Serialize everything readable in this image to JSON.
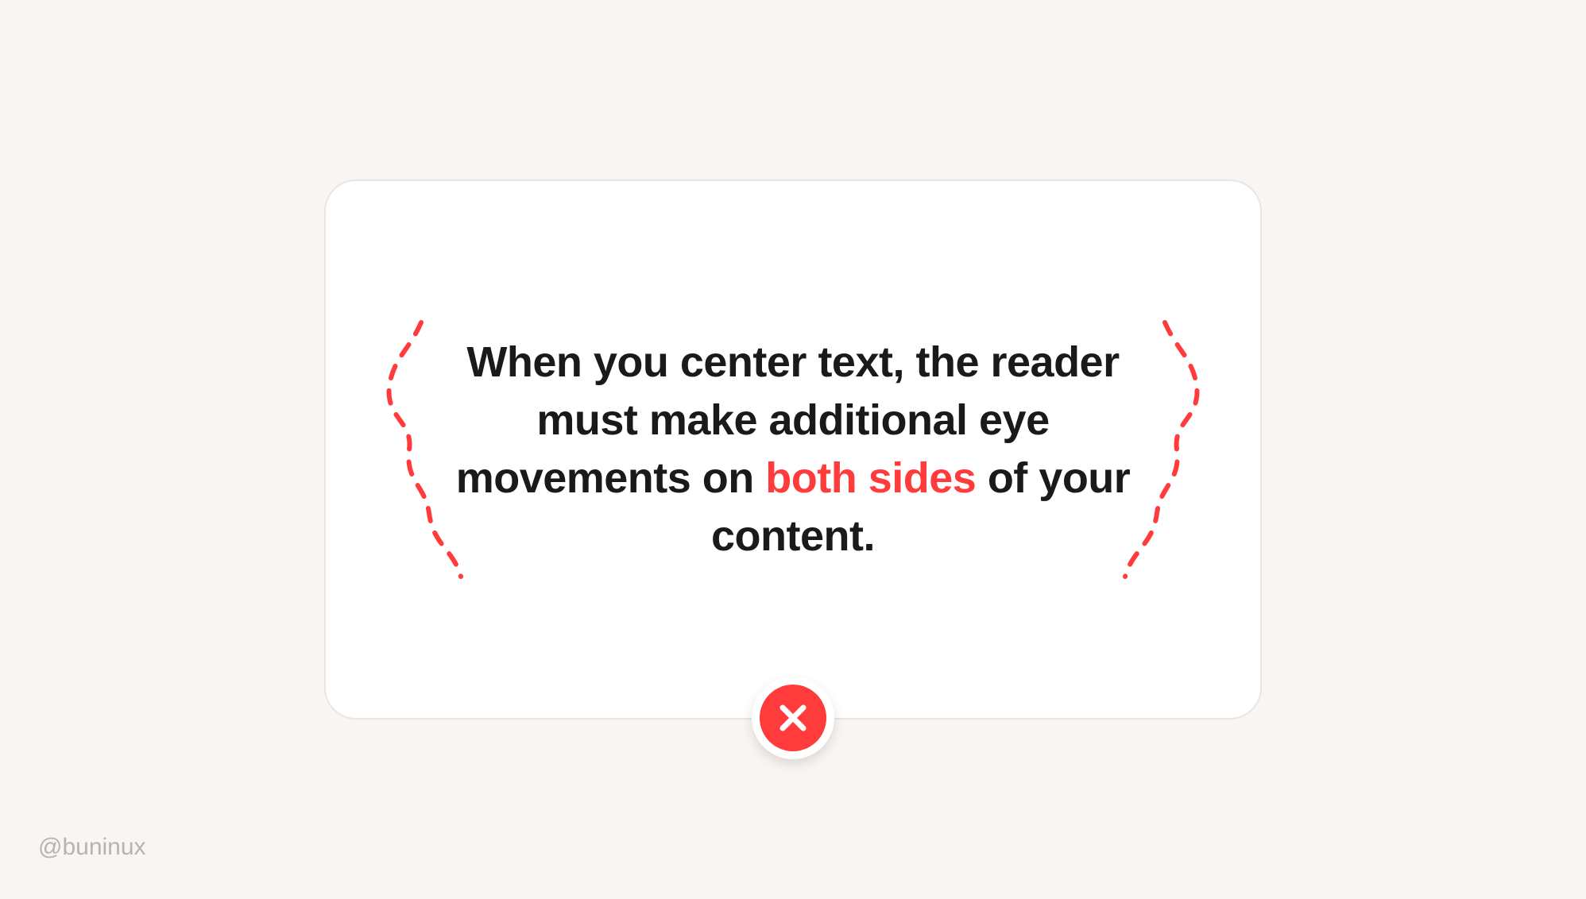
{
  "card": {
    "text_part1": "When you center text, the reader must make additional eye movements on ",
    "text_highlight": "both sides",
    "text_part2": " of your content."
  },
  "badge": {
    "semantic": "error-x-icon",
    "color": "#ff3b3b"
  },
  "squiggle": {
    "color": "#ff3b3b"
  },
  "attribution": "@buninux",
  "colors": {
    "background": "#f9f5f2",
    "card_bg": "#ffffff",
    "card_border": "#e8e5e2",
    "text": "#1a1a1a",
    "accent": "#ff3b3b",
    "attribution": "#b8b3af"
  }
}
